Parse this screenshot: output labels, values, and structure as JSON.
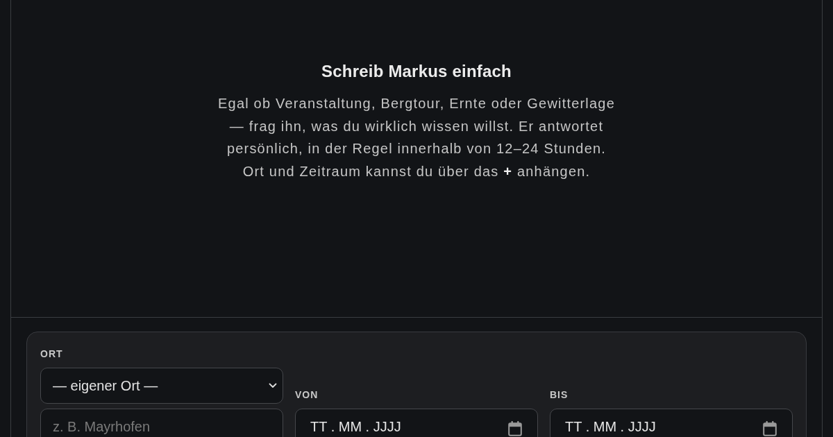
{
  "hero": {
    "title": "Schreib Markus einfach",
    "text_lines": [
      "Egal ob Veranstaltung, Bergtour, Ernte oder Gewitterlage",
      "— frag ihn, was du wirklich wissen willst. Er antwortet",
      "persönlich, in der Regel innerhalb von 12–24 Stunden.",
      "Ort und Zeitraum kannst du über das **+** anhängen."
    ]
  },
  "form": {
    "location": {
      "label": "ORT",
      "select_value": "— eigener Ort —",
      "input": {
        "placeholder": "z. B. Mayrhofen"
      }
    },
    "dates": [
      {
        "label": "VON",
        "placeholder": "TT . MM . JJJJ"
      },
      {
        "label": "BIS",
        "placeholder": "TT . MM . JJJJ"
      }
    ]
  }
}
